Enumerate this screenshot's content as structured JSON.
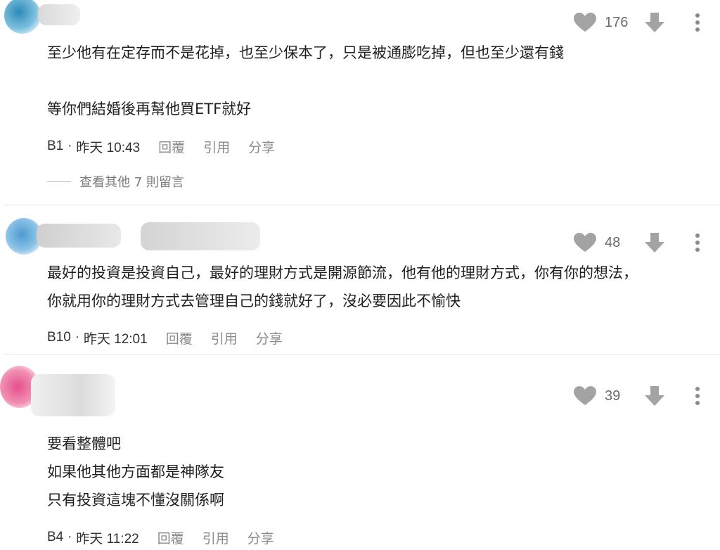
{
  "colors": {
    "icon": "#a3a3a3",
    "meta_link": "#8a8a8a",
    "divider": "#e3e3e3"
  },
  "comments": [
    {
      "floor": "B1",
      "time": "昨天 10:43",
      "likes": "176",
      "text": "至少他有在定存而不是花掉，也至少保本了，只是被通膨吃掉，但也至少還有錢\n\n等你們結婚後再幫他買ETF就好",
      "more_replies": "查看其他 7 則留言"
    },
    {
      "floor": "B10",
      "time": "昨天 12:01",
      "likes": "48",
      "text": "最好的投資是投資自己，最好的理財方式是開源節流，他有他的理財方式，你有你的想法，\n你就用你的理財方式去管理自己的錢就好了，沒必要因此不愉快"
    },
    {
      "floor": "B4",
      "time": "昨天 11:22",
      "likes": "39",
      "text": "要看整體吧\n如果他其他方面都是神隊友\n只有投資這塊不懂沒關係啊"
    }
  ],
  "labels": {
    "separator": "·",
    "reply": "回覆",
    "quote": "引用",
    "share": "分享"
  },
  "icons": {
    "like": "heart-icon",
    "dislike": "down-arrow-icon",
    "more": "more-vertical-icon"
  }
}
